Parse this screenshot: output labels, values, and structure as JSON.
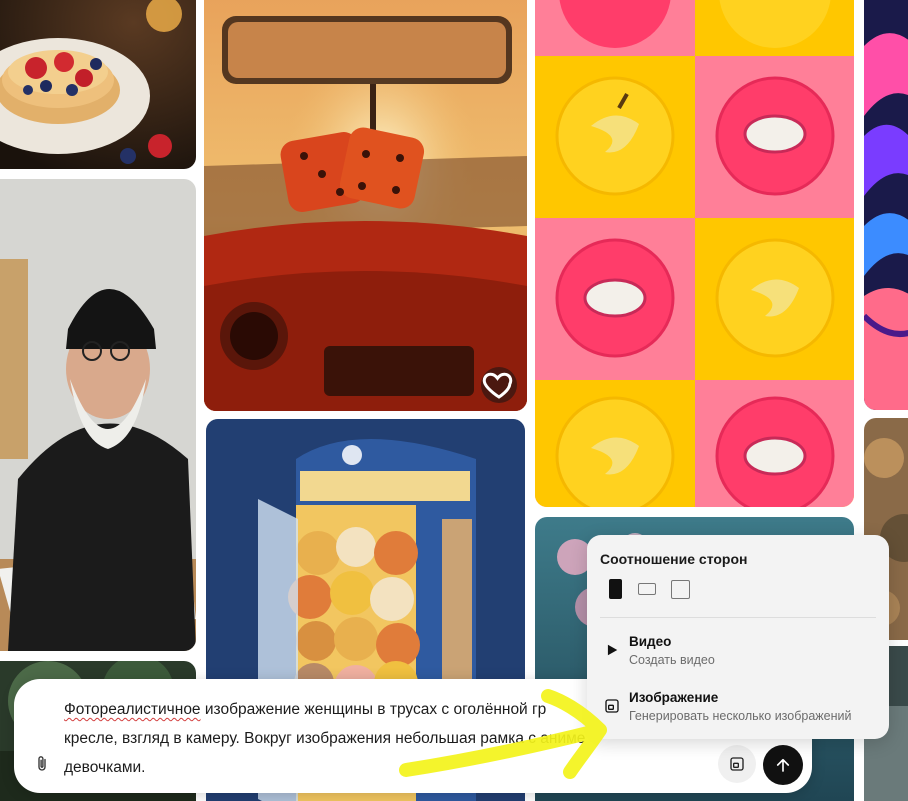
{
  "gallery": {
    "like_icon": "heart-outline-icon",
    "images": [
      "pancakes-with-berries",
      "fuzzy-dice-car-mirror",
      "banana-dragonfruit-plates",
      "abstract-neon-landscape",
      "old-man-at-laptop",
      "bear-phone-booth",
      "pink-flowers-water",
      "blurred-autumn-scene",
      "dark-forest-photo"
    ]
  },
  "prompt": {
    "text_part1": "Фотореалистичное",
    "text_part2": " изображение женщины в трусах с оголённой гр",
    "text_line2": "кресле, взгляд в камеру. Вокруг изображения небольшая рамка с аниме",
    "text_line3": "девочками.",
    "attach_icon": "paperclip-icon",
    "mode_icon": "image-mode-icon",
    "send_icon": "arrow-up-icon"
  },
  "aspect_popup": {
    "title": "Соотношение сторон",
    "ratios": [
      "portrait",
      "landscape",
      "square"
    ],
    "selected_ratio": "portrait",
    "options": [
      {
        "title": "Видео",
        "subtitle": "Создать видео",
        "icon": "play-icon"
      },
      {
        "title": "Изображение",
        "subtitle": "Генерировать несколько изображений",
        "icon": "image-generate-icon"
      }
    ]
  },
  "colors": {
    "send_button": "#111111",
    "popup_bg": "#f3f3f3",
    "scribble": "#f3f31a"
  }
}
